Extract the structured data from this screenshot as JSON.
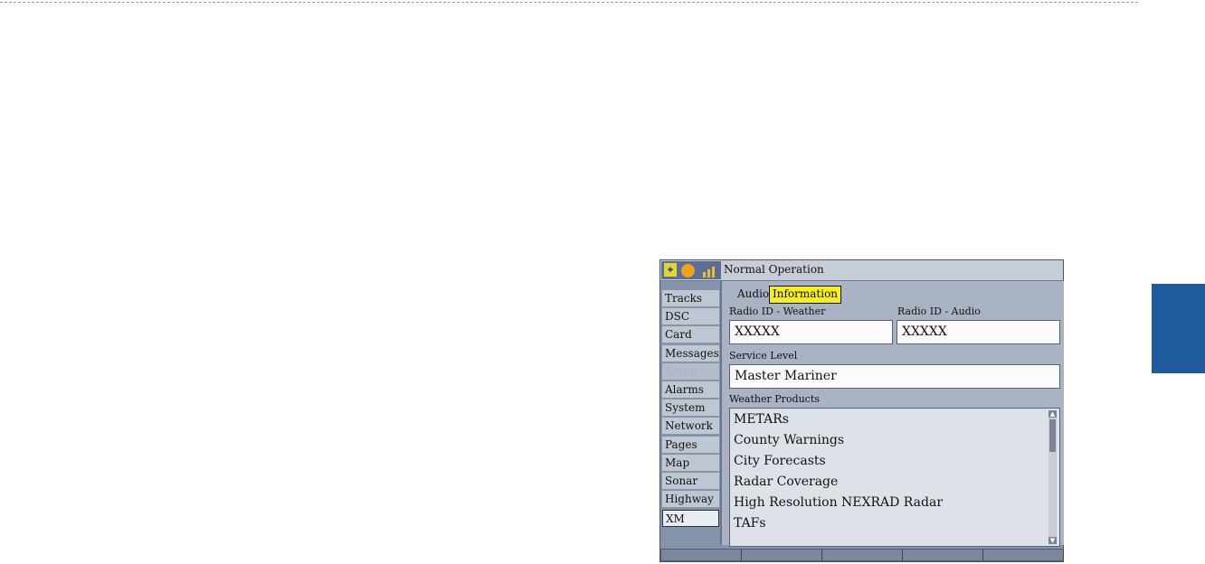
{
  "header": {
    "title": "Normal Operation"
  },
  "sidebar": {
    "items": [
      {
        "label": "Tracks",
        "state": "normal"
      },
      {
        "label": "DSC",
        "state": "normal"
      },
      {
        "label": "Card",
        "state": "normal"
      },
      {
        "label": "Messages",
        "state": "normal"
      },
      {
        "label": "Setup",
        "state": "dim"
      },
      {
        "label": "Alarms",
        "state": "normal"
      },
      {
        "label": "System",
        "state": "normal"
      },
      {
        "label": "Network",
        "state": "normal"
      },
      {
        "label": "Pages",
        "state": "normal"
      },
      {
        "label": "Map",
        "state": "normal"
      },
      {
        "label": "Sonar",
        "state": "normal"
      },
      {
        "label": "Highway",
        "state": "normal"
      },
      {
        "label": "XM",
        "state": "selected"
      }
    ]
  },
  "tabs": [
    {
      "label": "Audio",
      "active": false
    },
    {
      "label": "Information",
      "active": true
    }
  ],
  "fields": {
    "radio_id_weather": {
      "label": "Radio ID - Weather",
      "value": "XXXXX"
    },
    "radio_id_audio": {
      "label": "Radio ID - Audio",
      "value": "XXXXX"
    },
    "service_level": {
      "label": "Service Level",
      "value": "Master Mariner"
    }
  },
  "weather_products": {
    "label": "Weather Products",
    "items": [
      "METARs",
      "County Warnings",
      "City Forecasts",
      "Radar Coverage",
      "High Resolution NEXRAD Radar",
      "TAFs"
    ]
  },
  "colors": {
    "accent_tab": "#1e5a9c",
    "active_tab": "#f7ee1e",
    "screen_bg": "#8494ab"
  },
  "icons": [
    "gps-icon",
    "sun-icon",
    "signal-icon"
  ]
}
